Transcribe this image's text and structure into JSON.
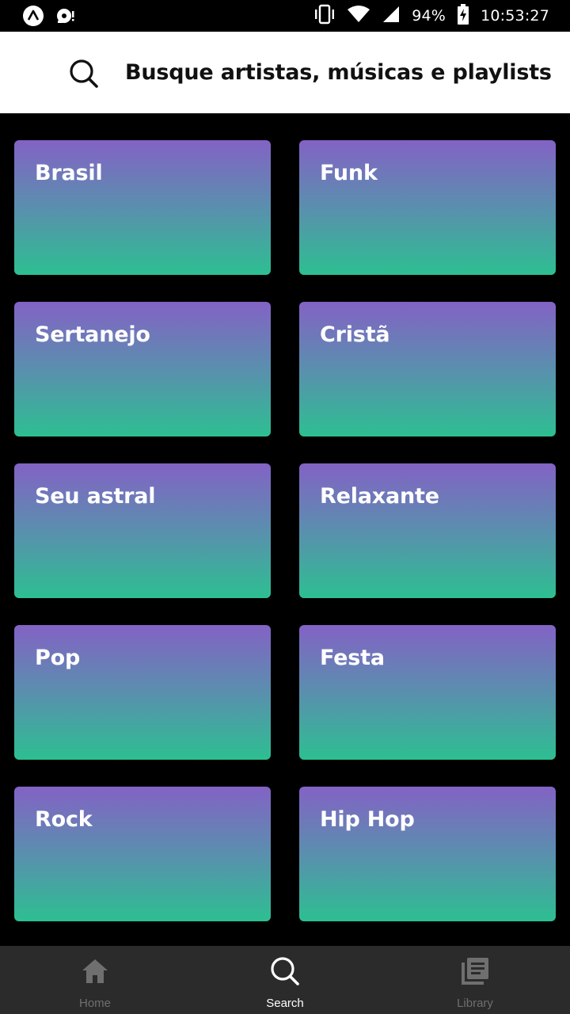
{
  "status_bar": {
    "battery": "94%",
    "time": "10:53:27",
    "icons": [
      "app-logo-icon",
      "music-disc-icon",
      "vibrate-icon",
      "wifi-icon",
      "signal-icon",
      "battery-charging-icon"
    ]
  },
  "search": {
    "prompt": "Busque artistas, músicas e playlists",
    "icon": "search-icon"
  },
  "genres": [
    {
      "label": "Brasil"
    },
    {
      "label": "Funk"
    },
    {
      "label": "Sertanejo"
    },
    {
      "label": "Cristã"
    },
    {
      "label": "Seu astral"
    },
    {
      "label": "Relaxante"
    },
    {
      "label": "Pop"
    },
    {
      "label": "Festa"
    },
    {
      "label": "Rock"
    },
    {
      "label": "Hip Hop"
    }
  ],
  "colors": {
    "card_gradient_top": "#8362c5",
    "card_gradient_bottom": "#2dbf91",
    "nav_background": "#2b2b2b",
    "nav_active": "#ffffff",
    "nav_inactive": "#6f6f6f"
  },
  "bottom_nav": {
    "items": [
      {
        "label": "Home",
        "icon": "home-icon",
        "active": false
      },
      {
        "label": "Search",
        "icon": "search-icon",
        "active": true
      },
      {
        "label": "Library",
        "icon": "library-icon",
        "active": false
      }
    ]
  }
}
